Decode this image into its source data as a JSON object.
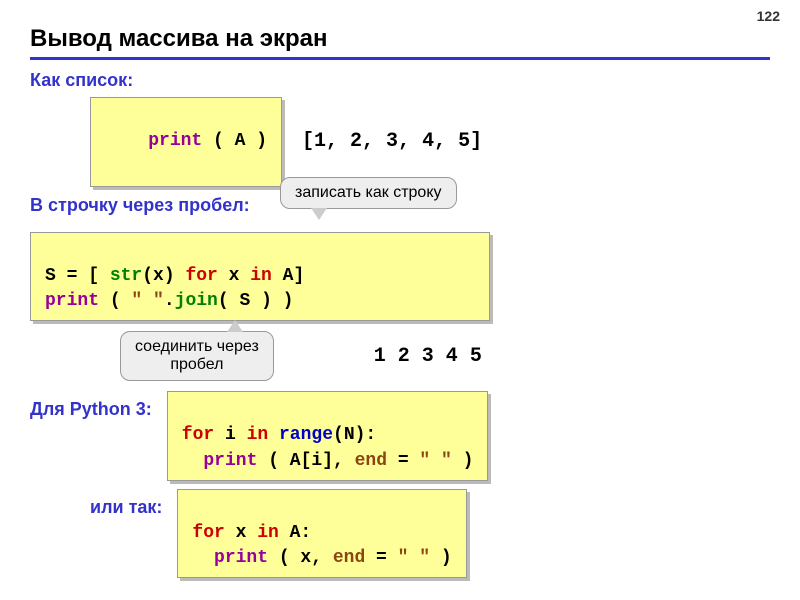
{
  "page_number": "122",
  "title": "Вывод массива на экран",
  "sub1": "Как список:",
  "code1": {
    "print": "print",
    "args": " ( A )"
  },
  "output1": "[1, 2, 3, 4, 5]",
  "sub2": "В строчку через пробел:",
  "callout1": "записать как строку",
  "code2_line1": {
    "prefix": "S = [ ",
    "str": "str",
    "mid": "(x) ",
    "for": "for",
    "x": " x ",
    "in": "in",
    "suffix": " A]"
  },
  "code2_line2": {
    "print": "print",
    "open": " ( ",
    "q1": "\" \"",
    "dot": ".",
    "join": "join",
    "args": "( S ) )"
  },
  "callout2": "соединить через\nпробел",
  "output2": "1 2 3 4 5",
  "sub3": "Для Python 3:",
  "code3_line1": {
    "for": "for",
    "i": " i ",
    "in": "in",
    "sp": " ",
    "range": "range",
    "args": "(N):"
  },
  "code3_line2": {
    "indent": "  ",
    "print": "print",
    "args1": " ( A[i], ",
    "end": "end",
    "eq": " = ",
    "q": "\" \"",
    "close": " )"
  },
  "sub4": "или так:",
  "code4_line1": {
    "for": "for",
    "x": " x ",
    "in": "in",
    "suffix": " A:"
  },
  "code4_line2": {
    "indent": "  ",
    "print": "print",
    "args1": " ( x, ",
    "end": "end",
    "eq": " = ",
    "q": "\" \"",
    "close": " )"
  }
}
